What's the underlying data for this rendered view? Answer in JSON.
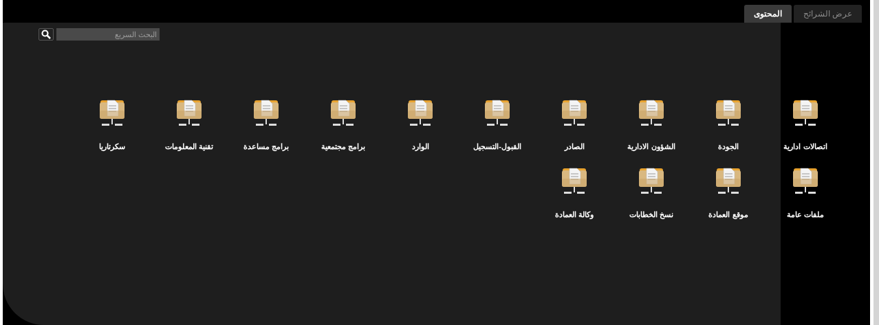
{
  "tabs": [
    {
      "label": "عرض الشرائح",
      "selected": false
    },
    {
      "label": "المحتوى",
      "selected": true
    }
  ],
  "search": {
    "placeholder": "البحث السريع"
  },
  "folders": [
    {
      "label": "اتصالات ادارية"
    },
    {
      "label": "الجودة"
    },
    {
      "label": "الشؤون الادارية"
    },
    {
      "label": "الصادر"
    },
    {
      "label": "القبول-التسجيل"
    },
    {
      "label": "الوارد"
    },
    {
      "label": "برامج مجتمعية"
    },
    {
      "label": "برامج مساعدة"
    },
    {
      "label": "تقنية المعلومات"
    },
    {
      "label": "سكرتاريا"
    },
    {
      "label": "ملفات عامة"
    },
    {
      "label": "موقع العمادة"
    },
    {
      "label": "نسخ الخطابات"
    },
    {
      "label": "وكالة العمادة"
    }
  ]
}
